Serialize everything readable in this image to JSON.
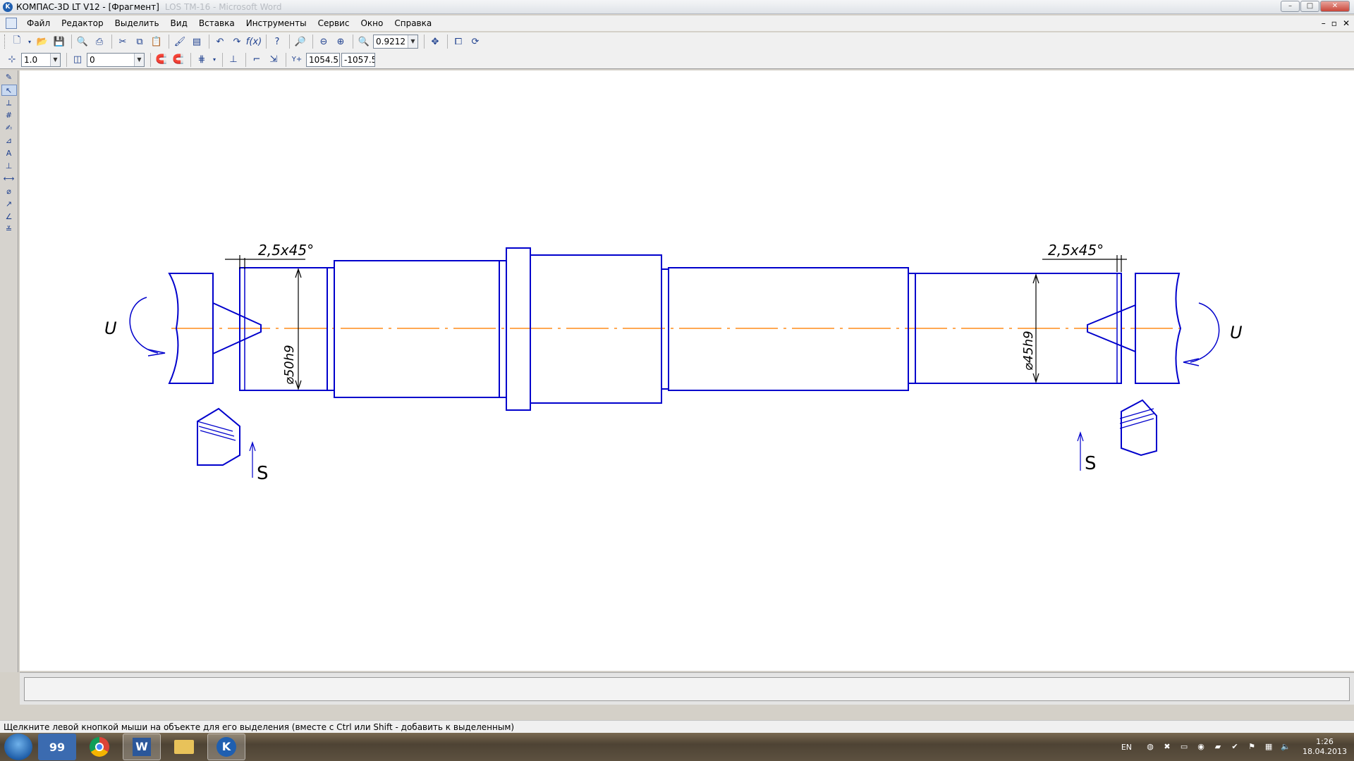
{
  "window": {
    "title": "КОМПАС-3D LT V12 - [Фрагмент]",
    "background_title": "LOS TM-16 - Microsoft Word"
  },
  "menu": [
    "Файл",
    "Редактор",
    "Выделить",
    "Вид",
    "Вставка",
    "Инструменты",
    "Сервис",
    "Окно",
    "Справка"
  ],
  "toolbar": {
    "zoom_value": "0.9212",
    "step_value": "1.0",
    "layer_value": "0",
    "coord_x": "1054.5",
    "coord_y": "-1057.5"
  },
  "drawing": {
    "line_color": "#0000cc",
    "axis_color": "#ff8c1a",
    "annotations": {
      "chamfer_left": "2,5x45°",
      "chamfer_right": "2,5x45°",
      "diameter_left": "⌀50h9",
      "diameter_right": "⌀45h9",
      "rotation_left": "U",
      "rotation_right": "U",
      "feed_left": "S",
      "feed_right": "S"
    }
  },
  "status": {
    "hint": "Щелкните левой кнопкой мыши на объекте для его выделения (вместе с Ctrl или Shift - добавить к выделенным)"
  },
  "taskbar": {
    "language": "EN",
    "time": "1:26",
    "date": "18.04.2013",
    "apps": [
      "total-commander",
      "chrome",
      "word",
      "explorer",
      "kompas"
    ]
  }
}
